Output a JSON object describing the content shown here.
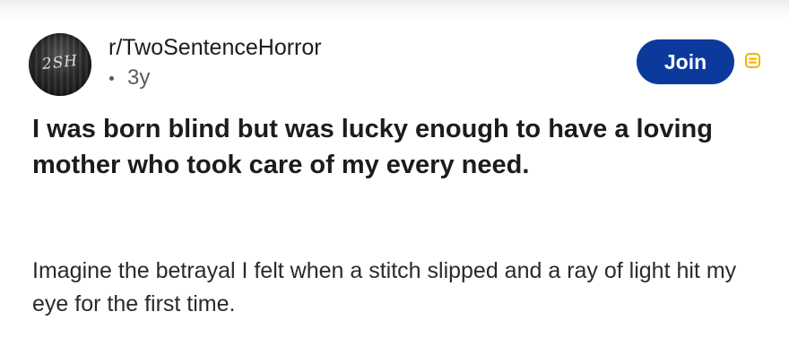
{
  "post": {
    "subreddit": "r/TwoSentenceHorror",
    "age": "3y",
    "join_label": "Join",
    "avatar_logo_text": "2SH",
    "title": "I was born blind but was lucky enough to have a loving mother who took care of my every need.",
    "body": "Imagine the betrayal I felt when a stitch slipped and a ray of light hit my eye for the first time."
  },
  "icons": {
    "avatar": "subreddit-avatar-icon",
    "badge": "yellow-mod-badge-icon"
  },
  "colors": {
    "join_button": "#0b3a9c",
    "badge": "#f5b400",
    "text": "#1c1c1c",
    "meta": "#5b5b5b"
  }
}
